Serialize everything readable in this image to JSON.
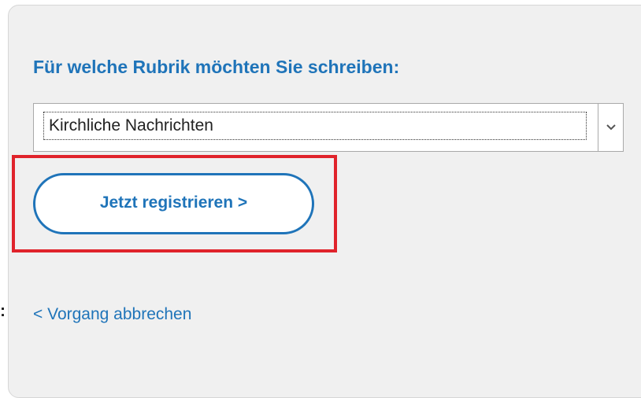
{
  "form": {
    "heading": "Für welche Rubrik möchten Sie schreiben:",
    "category_select": {
      "selected_value": "Kirchliche Nachrichten",
      "arrow_icon": "chevron-down-icon"
    },
    "register_button_label": "Jetzt registrieren >",
    "cancel_link_label": "< Vorgang abbrechen"
  },
  "side_fragment": ":",
  "colors": {
    "accent": "#1f74b9",
    "panel_background": "#f0f0f0",
    "highlight": "#e0232b"
  }
}
